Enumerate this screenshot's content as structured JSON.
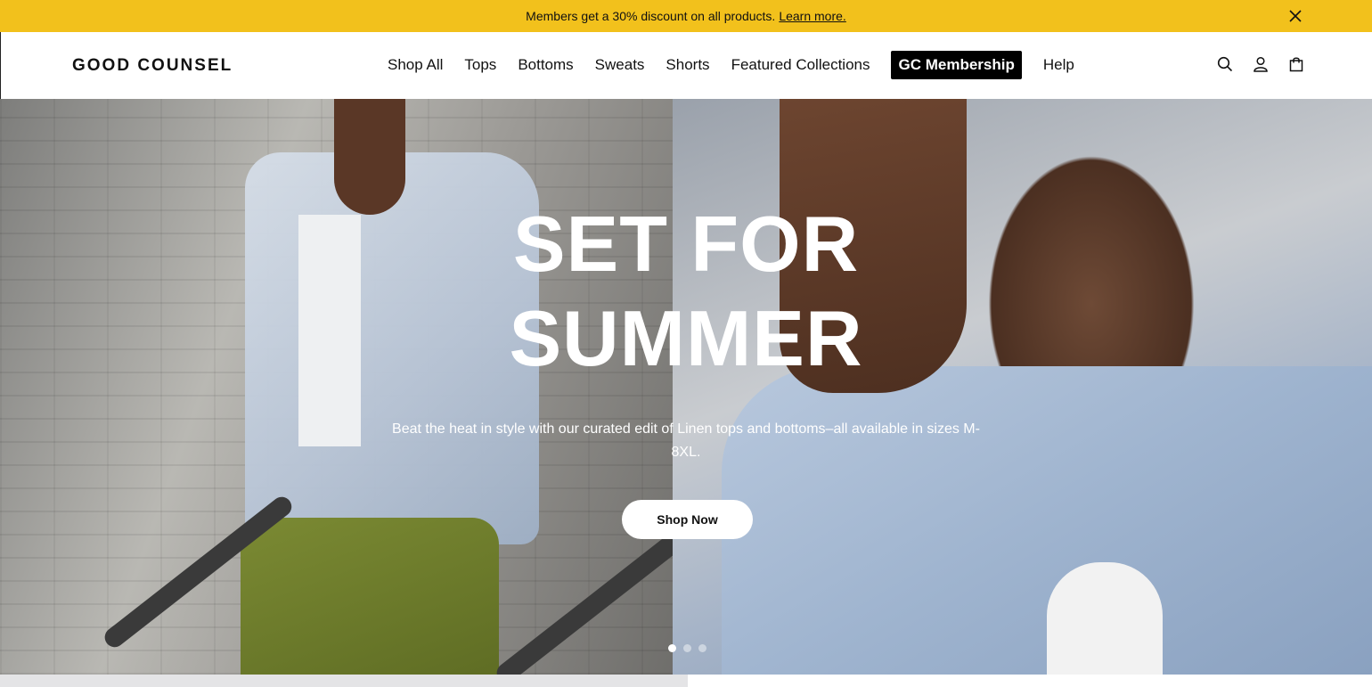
{
  "announcement": {
    "text": "Members get a 30% discount on all products.",
    "link_text": "Learn more.",
    "close_icon": "close-icon",
    "background": "#f2c11c"
  },
  "header": {
    "logo": "GOOD COUNSEL",
    "nav": [
      {
        "label": "Shop All"
      },
      {
        "label": "Tops"
      },
      {
        "label": "Bottoms"
      },
      {
        "label": "Sweats"
      },
      {
        "label": "Shorts"
      },
      {
        "label": "Featured Collections"
      },
      {
        "label": "GC Membership",
        "highlighted": true
      },
      {
        "label": "Help"
      }
    ],
    "icons": [
      "search-icon",
      "account-icon",
      "bag-icon"
    ]
  },
  "hero": {
    "title_line1": "SET FOR",
    "title_line2": "SUMMER",
    "subtitle": "Beat the heat in style with our curated edit of Linen tops and bottoms–all available in sizes M-8XL.",
    "button_label": "Shop Now",
    "slides_total": 3,
    "active_slide": 1
  }
}
